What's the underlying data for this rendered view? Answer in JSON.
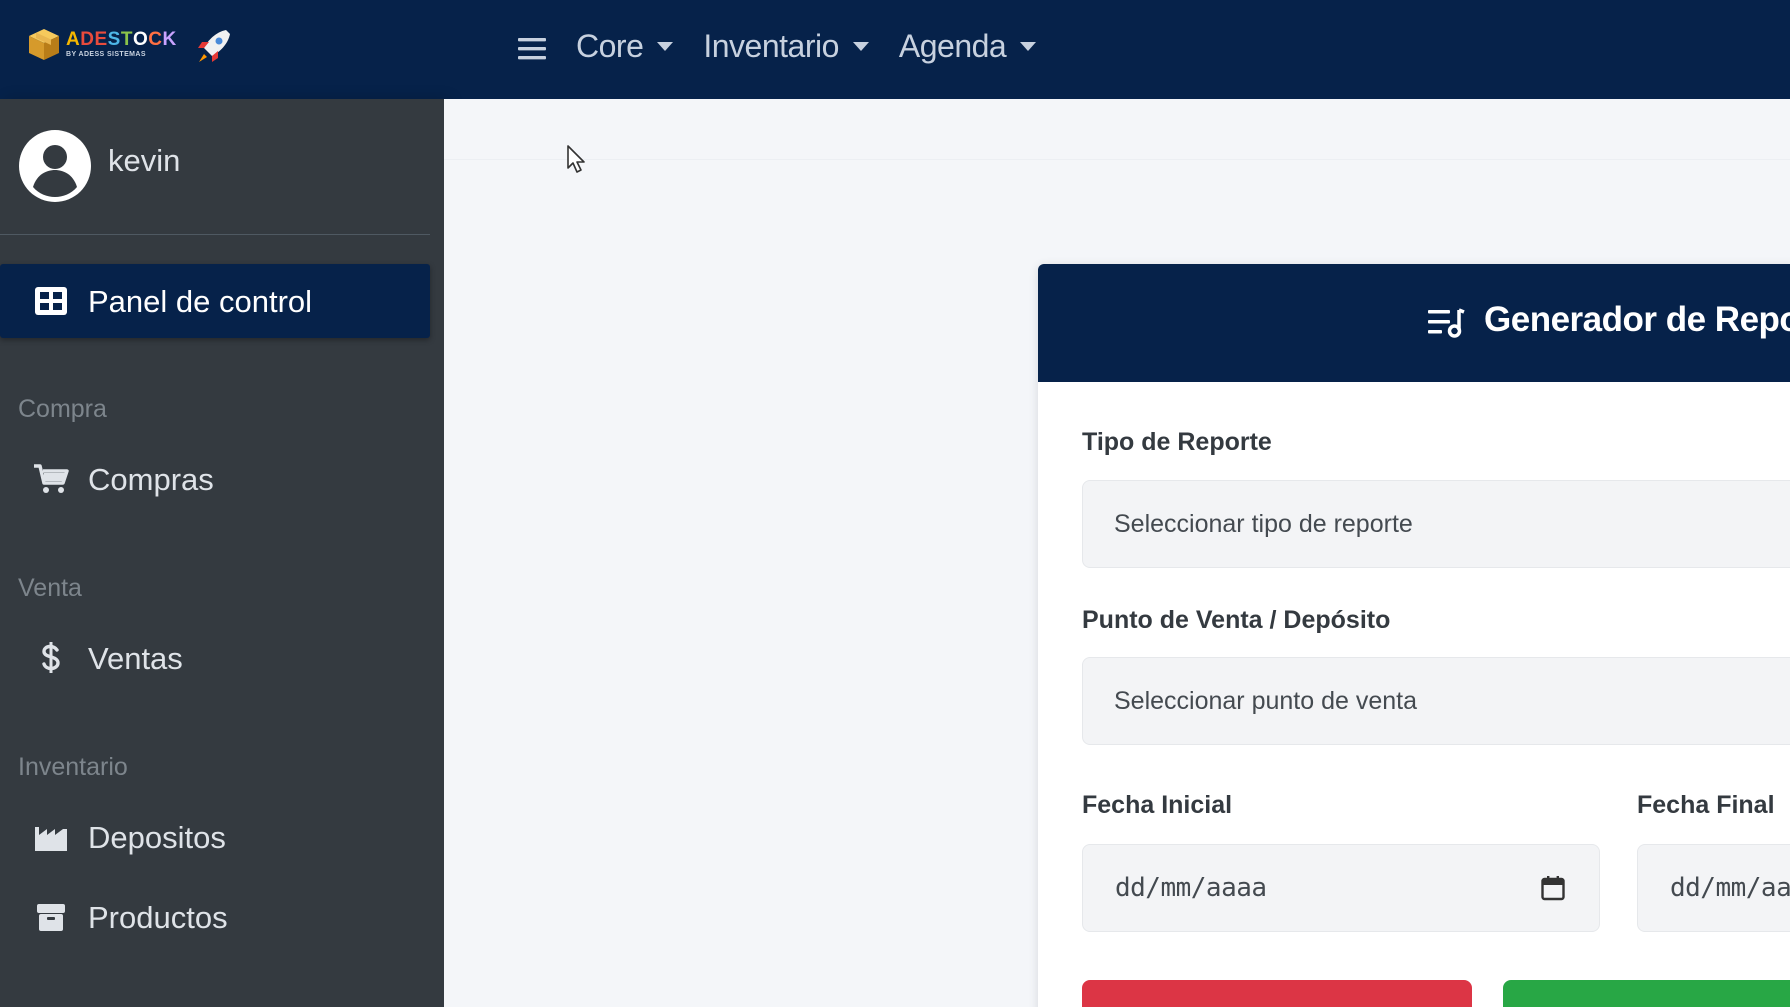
{
  "brand": {
    "name_parts": [
      "A",
      "DE",
      "S",
      "T",
      "O",
      "C",
      "K"
    ],
    "name_colors": [
      "#f5b700",
      "#e94b3c",
      "#4db6e8",
      "#8bc34a",
      "#ffffff",
      "#ff7043",
      "#c9a3ff"
    ],
    "subtitle": "BY ADESS SISTEMAS"
  },
  "topnav": {
    "menu": [
      {
        "label": "Core"
      },
      {
        "label": "Inventario"
      },
      {
        "label": "Agenda"
      }
    ]
  },
  "user": {
    "name": "kevin"
  },
  "sidebar": {
    "active": {
      "label": "Panel de control",
      "icon": "grid-icon"
    },
    "sections": [
      {
        "header": "Compra",
        "items": [
          {
            "label": "Compras",
            "icon": "cart-icon"
          }
        ]
      },
      {
        "header": "Venta",
        "items": [
          {
            "label": "Ventas",
            "icon": "dollar-icon"
          }
        ]
      },
      {
        "header": "Inventario",
        "items": [
          {
            "label": "Depositos",
            "icon": "warehouse-icon"
          },
          {
            "label": "Productos",
            "icon": "box-icon"
          }
        ]
      }
    ]
  },
  "report_card": {
    "title": "Generador de Reportes",
    "tipo_label": "Tipo de Reporte",
    "tipo_value": "Seleccionar tipo de reporte",
    "punto_label": "Punto de Venta / Depósito",
    "punto_value": "Seleccionar punto de venta",
    "fecha_inicial_label": "Fecha Inicial",
    "fecha_inicial_value": "dd/mm/aaaa",
    "fecha_final_label": "Fecha Final",
    "fecha_final_value": "dd/mm/aaaa"
  },
  "colors": {
    "navbar": "#06224a",
    "sidebar": "#343a40",
    "danger": "#dc3545",
    "success": "#28a745"
  }
}
